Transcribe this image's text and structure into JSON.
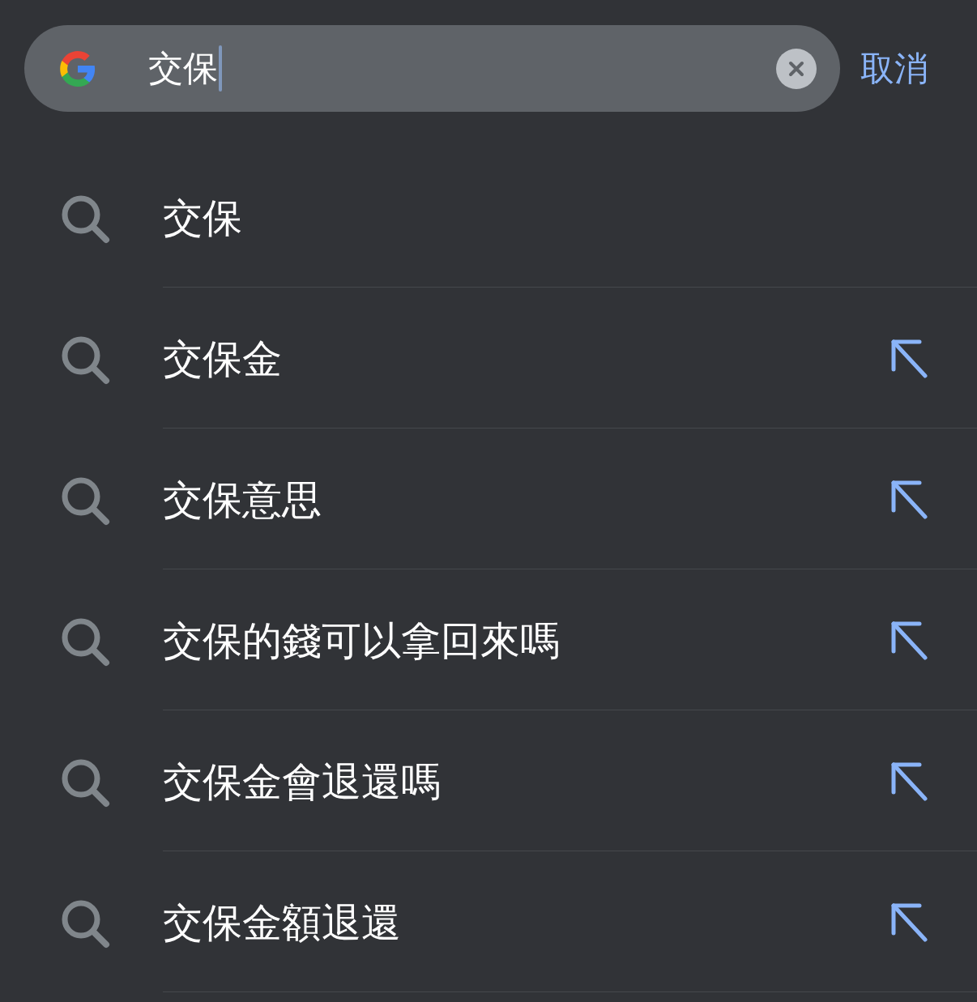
{
  "search": {
    "query": "交保",
    "focused": true
  },
  "cancel": "取消",
  "suggestions": [
    {
      "text": "交保",
      "kind": "typed"
    },
    {
      "text": "交保金",
      "kind": "suggestion"
    },
    {
      "text": "交保意思",
      "kind": "suggestion"
    },
    {
      "text": "交保的錢可以拿回來嗎",
      "kind": "suggestion"
    },
    {
      "text": "交保金會退還嗎",
      "kind": "suggestion"
    },
    {
      "text": "交保金額退還",
      "kind": "suggestion"
    }
  ]
}
